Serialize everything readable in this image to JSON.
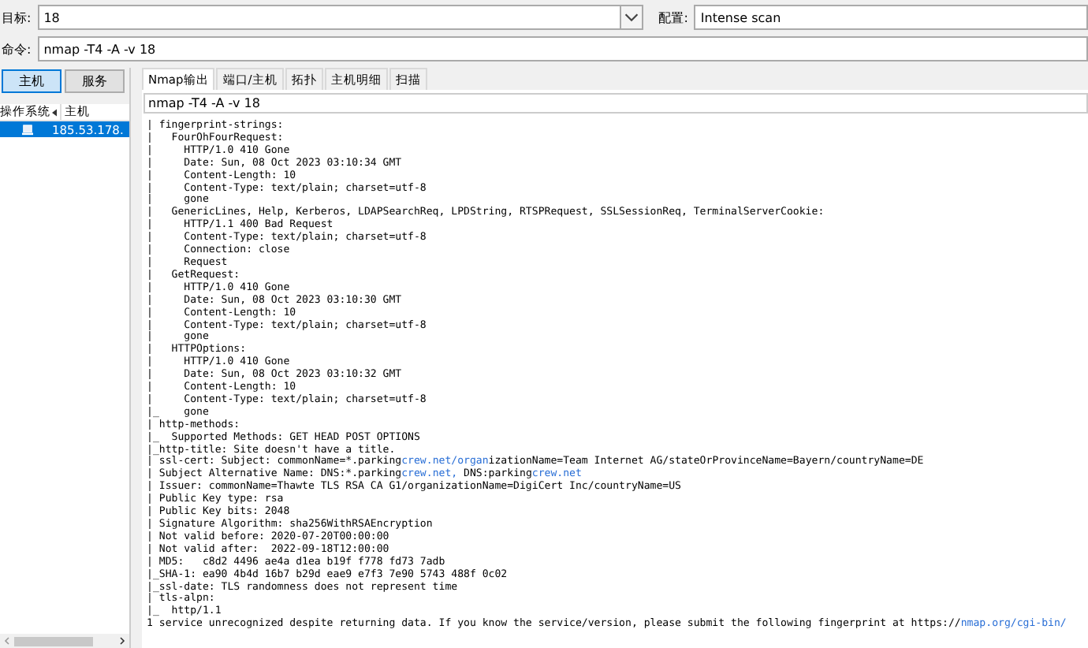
{
  "target": {
    "label": "目标:",
    "value": "18"
  },
  "profile": {
    "label": "配置:",
    "value": "Intense scan"
  },
  "command": {
    "label": "命令:",
    "value": "nmap -T4 -A -v 18"
  },
  "view_buttons": [
    {
      "label": "主机",
      "selected": true
    },
    {
      "label": "服务",
      "selected": false
    }
  ],
  "host_list": {
    "columns": [
      "操作系统",
      "主机"
    ],
    "rows": [
      {
        "host": "185.53.178.",
        "selected": true
      }
    ]
  },
  "tabs": [
    {
      "label": "Nmap输出",
      "selected": true
    },
    {
      "label": "端口/主机",
      "selected": false
    },
    {
      "label": "拓扑",
      "selected": false
    },
    {
      "label": "主机明细",
      "selected": false
    },
    {
      "label": "扫描",
      "selected": false
    }
  ],
  "output_command": "nmap -T4 -A -v 18",
  "output_lines": [
    {
      "text": "| fingerprint-strings:"
    },
    {
      "text": "|   FourOhFourRequest:"
    },
    {
      "text": "|     HTTP/1.0 410 Gone"
    },
    {
      "text": "|     Date: Sun, 08 Oct 2023 03:10:34 GMT"
    },
    {
      "text": "|     Content-Length: 10"
    },
    {
      "text": "|     Content-Type: text/plain; charset=utf-8"
    },
    {
      "text": "|     gone"
    },
    {
      "text": "|   GenericLines, Help, Kerberos, LDAPSearchReq, LPDString, RTSPRequest, SSLSessionReq, TerminalServerCookie:"
    },
    {
      "text": "|     HTTP/1.1 400 Bad Request"
    },
    {
      "text": "|     Content-Type: text/plain; charset=utf-8"
    },
    {
      "text": "|     Connection: close"
    },
    {
      "text": "|     Request"
    },
    {
      "text": "|   GetRequest:"
    },
    {
      "text": "|     HTTP/1.0 410 Gone"
    },
    {
      "text": "|     Date: Sun, 08 Oct 2023 03:10:30 GMT"
    },
    {
      "text": "|     Content-Length: 10"
    },
    {
      "text": "|     Content-Type: text/plain; charset=utf-8"
    },
    {
      "text": "|     gone"
    },
    {
      "text": "|   HTTPOptions:"
    },
    {
      "text": "|     HTTP/1.0 410 Gone"
    },
    {
      "text": "|     Date: Sun, 08 Oct 2023 03:10:32 GMT"
    },
    {
      "text": "|     Content-Length: 10"
    },
    {
      "text": "|     Content-Type: text/plain; charset=utf-8"
    },
    {
      "text": "|_    gone"
    },
    {
      "text": "| http-methods:"
    },
    {
      "text": "|_  Supported Methods: GET HEAD POST OPTIONS"
    },
    {
      "text": "|_http-title: Site doesn't have a title."
    },
    {
      "parts": [
        {
          "text": "| ssl-cert: Subject: commonName=*.parking",
          "kind": "plain"
        },
        {
          "text": "crew.net/organ",
          "kind": "link"
        },
        {
          "text": "izationName=Team Internet AG/stateOrProvinceName=Bayern/countryName=DE",
          "kind": "plain"
        }
      ]
    },
    {
      "parts": [
        {
          "text": "| Subject Alternative Name: DNS:*.parking",
          "kind": "plain"
        },
        {
          "text": "crew.net,",
          "kind": "link"
        },
        {
          "text": " DNS:parking",
          "kind": "plain"
        },
        {
          "text": "crew.net",
          "kind": "link"
        }
      ]
    },
    {
      "text": "| Issuer: commonName=Thawte TLS RSA CA G1/organizationName=DigiCert Inc/countryName=US"
    },
    {
      "text": "| Public Key type: rsa"
    },
    {
      "text": "| Public Key bits: 2048"
    },
    {
      "text": "| Signature Algorithm: sha256WithRSAEncryption"
    },
    {
      "text": "| Not valid before: 2020-07-20T00:00:00"
    },
    {
      "text": "| Not valid after:  2022-09-18T12:00:00"
    },
    {
      "text": "| MD5:   c8d2 4496 ae4a d1ea b19f f778 fd73 7adb"
    },
    {
      "text": "|_SHA-1: ea90 4b4d 16b7 b29d eae9 e7f3 7e90 5743 488f 0c02"
    },
    {
      "text": "|_ssl-date: TLS randomness does not represent time"
    },
    {
      "text": "| tls-alpn:"
    },
    {
      "text": "|_  http/1.1"
    },
    {
      "parts": [
        {
          "text": "1 service unrecognized despite returning data. If you know the service/version, please submit the following fingerprint at https://",
          "kind": "plain"
        },
        {
          "text": "nmap.org/cgi-bin/",
          "kind": "link"
        }
      ]
    }
  ]
}
